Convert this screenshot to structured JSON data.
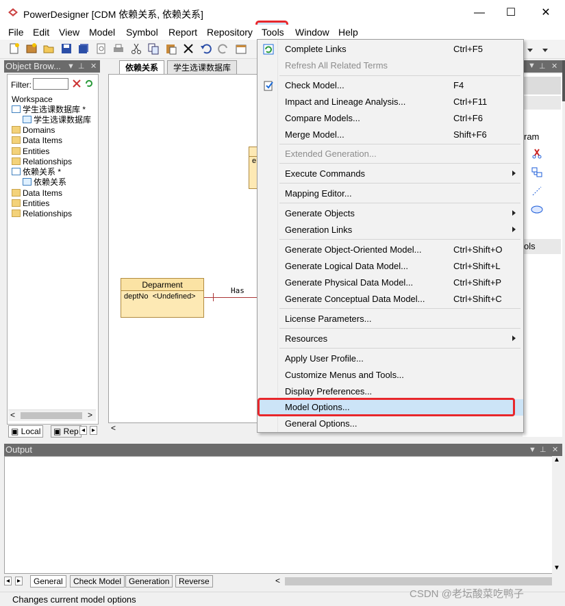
{
  "window": {
    "title": "PowerDesigner [CDM 依赖关系, 依赖关系]",
    "controls": {
      "minimize": "—",
      "maximize": "☐",
      "close": "✕"
    }
  },
  "menubar": {
    "items": [
      "File",
      "Edit",
      "View",
      "Model",
      "Symbol",
      "Report",
      "Repository",
      "Tools",
      "Window",
      "Help"
    ],
    "active": "Tools"
  },
  "object_browser": {
    "title": "Object Brow...",
    "filter_label": "Filter:",
    "filter_value": "",
    "tree": [
      {
        "label": "Workspace"
      },
      {
        "label": "学生选课数据库 *"
      },
      {
        "label": "学生选课数据库"
      },
      {
        "label": "Domains"
      },
      {
        "label": "Data Items"
      },
      {
        "label": "Entities"
      },
      {
        "label": "Relationships"
      },
      {
        "label": "依赖关系 *"
      },
      {
        "label": "依赖关系"
      },
      {
        "label": "Data Items"
      },
      {
        "label": "Entities"
      },
      {
        "label": "Relationships"
      }
    ],
    "tabs": [
      "Local",
      "Rep"
    ]
  },
  "document_tabs": [
    "依赖关系",
    "学生选课数据库"
  ],
  "diagram": {
    "entity": {
      "name": "Deparment",
      "attr_name": "deptNo",
      "attr_type": "<Undefined>"
    },
    "partial_entity_letter": "e",
    "relationship_label": "Has"
  },
  "right_palette": {
    "label1": "ram",
    "label2": "ols"
  },
  "tools_menu": {
    "items": [
      {
        "label": "Complete Links",
        "shortcut": "Ctrl+F5",
        "icon": "complete-links-icon"
      },
      {
        "label": "Refresh All Related Terms",
        "shortcut": "",
        "disabled": true
      },
      {
        "label": "Check Model...",
        "shortcut": "F4",
        "icon": "check-model-icon"
      },
      {
        "label": "Impact and Lineage Analysis...",
        "shortcut": "Ctrl+F11"
      },
      {
        "label": "Compare Models...",
        "shortcut": "Ctrl+F6"
      },
      {
        "label": "Merge Model...",
        "shortcut": "Shift+F6"
      },
      {
        "label": "Extended Generation...",
        "shortcut": "",
        "disabled": true
      },
      {
        "label": "Execute Commands",
        "submenu": true
      },
      {
        "label": "Mapping Editor..."
      },
      {
        "label": "Generate Objects",
        "submenu": true
      },
      {
        "label": "Generation Links",
        "submenu": true
      },
      {
        "label": "Generate Object-Oriented Model...",
        "shortcut": "Ctrl+Shift+O"
      },
      {
        "label": "Generate Logical Data Model...",
        "shortcut": "Ctrl+Shift+L"
      },
      {
        "label": "Generate Physical Data Model...",
        "shortcut": "Ctrl+Shift+P"
      },
      {
        "label": "Generate Conceptual Data Model...",
        "shortcut": "Ctrl+Shift+C"
      },
      {
        "label": "License Parameters..."
      },
      {
        "label": "Resources",
        "submenu": true
      },
      {
        "label": "Apply User Profile..."
      },
      {
        "label": "Customize Menus and Tools..."
      },
      {
        "label": "Display Preferences..."
      },
      {
        "label": "Model Options...",
        "highlighted": true
      },
      {
        "label": "General Options..."
      }
    ]
  },
  "output": {
    "title": "Output",
    "tabs": [
      "General",
      "Check Model",
      "Generation",
      "Reverse"
    ]
  },
  "status_bar": {
    "message": "Changes current model options"
  },
  "watermark": "CSDN @老坛酸菜吃鸭子",
  "colors": {
    "highlight_border": "#e8262b",
    "menu_highlight": "#cce4f7",
    "entity_fill": "#fde9b4"
  }
}
